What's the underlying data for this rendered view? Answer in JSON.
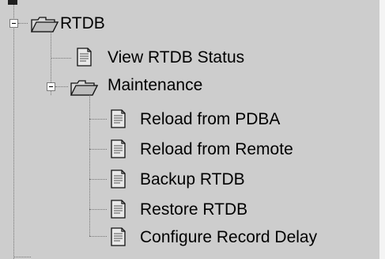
{
  "tree": {
    "root": {
      "label": "RTDB",
      "icon": "open-folder-icon",
      "expander": "minus"
    },
    "root_children": [
      {
        "label": "View RTDB Status",
        "icon": "document-icon"
      }
    ],
    "maintenance": {
      "label": "Maintenance",
      "icon": "open-folder-icon",
      "expander": "minus",
      "items": [
        {
          "label": "Reload from PDBA",
          "icon": "document-icon"
        },
        {
          "label": "Reload from Remote",
          "icon": "document-icon"
        },
        {
          "label": "Backup RTDB",
          "icon": "document-icon"
        },
        {
          "label": "Restore RTDB",
          "icon": "document-icon"
        },
        {
          "label": "Configure Record Delay",
          "icon": "document-icon"
        }
      ]
    }
  },
  "colors": {
    "background": "#cdcdcd",
    "text": "#000000",
    "tree_lines": "#777777",
    "folder": "#d8d8d8"
  }
}
